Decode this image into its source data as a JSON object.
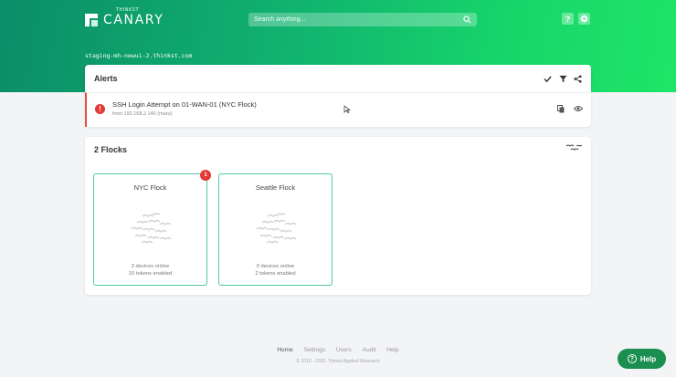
{
  "header": {
    "logo_small": "THINKST",
    "logo_big": "CANARY",
    "search_placeholder": "Search anything...",
    "hostname": "staging-mh-newui-2.thinkst.com"
  },
  "alerts": {
    "title": "Alerts",
    "items": [
      {
        "badge": "!",
        "title": "SSH Login Attempt on 01-WAN-01 (NYC Flock)",
        "subtitle": "from 192.168.2.140 (maru)"
      }
    ]
  },
  "flocks": {
    "title": "2 Flocks",
    "items": [
      {
        "name": "NYC Flock",
        "devices": "2 devices online",
        "tokens": "10 tokens enabled",
        "badge": "1"
      },
      {
        "name": "Seattle Flock",
        "devices": "0 devices online",
        "tokens": "2 tokens enabled"
      }
    ]
  },
  "footer": {
    "nav": [
      "Home",
      "Settings",
      "Users",
      "Audit",
      "Help"
    ],
    "copyright": "© 2015 - 2020, Thinkst Applied Research"
  },
  "help_button": {
    "label": "Help"
  },
  "colors": {
    "brand_green": "#11b56f",
    "alert_red": "#e53935",
    "flock_border": "#4fc9a4",
    "help_green": "#1b8f4f"
  }
}
